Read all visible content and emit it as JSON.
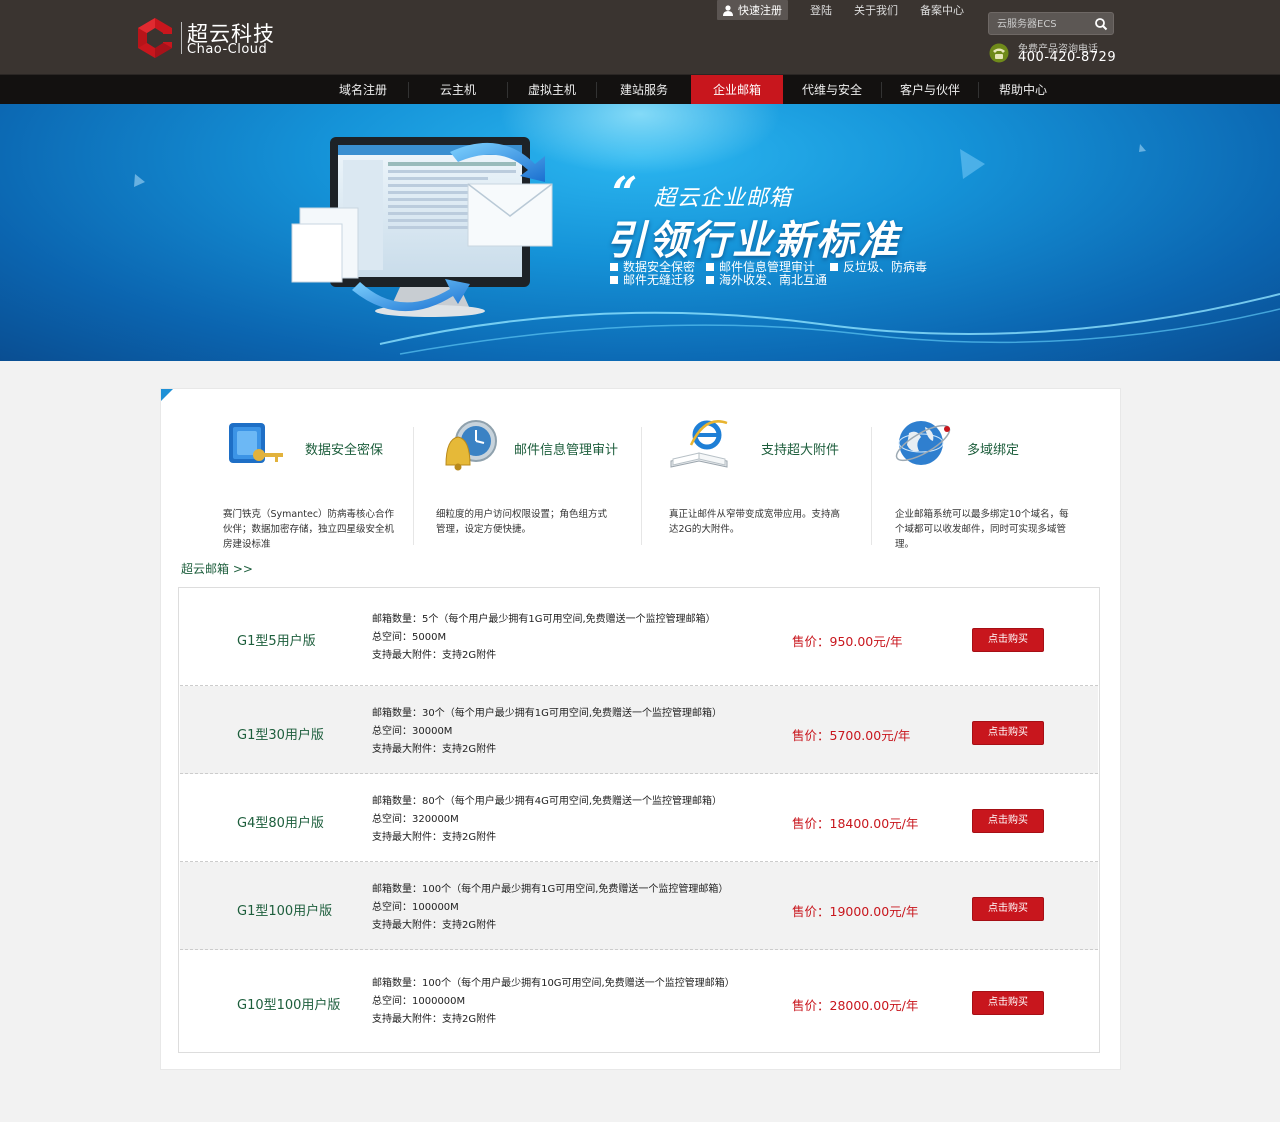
{
  "header": {
    "logo_cn": "超云科技",
    "logo_en": "Chao-Cloud",
    "quick_register": "快速注册",
    "links": [
      "登陆",
      "关于我们",
      "备案中心"
    ],
    "search_placeholder": "云服务器ECS",
    "hotline_label": "免费产品咨询电话",
    "hotline_number": "400-420-8729"
  },
  "nav": {
    "items": [
      "域名注册",
      "云主机",
      "虚拟主机",
      "建站服务",
      "企业邮箱",
      "代维与安全",
      "客户与伙伴",
      "帮助中心"
    ],
    "active_index": 4
  },
  "banner": {
    "quote_mark": "“",
    "title1": "超云企业邮箱",
    "title2": "引领行业新标准",
    "features": [
      "数据安全保密",
      "邮件信息管理审计",
      "反垃圾、防病毒",
      "邮件无缝迁移",
      "海外收发、南北互通"
    ]
  },
  "features": [
    {
      "title": "数据安全密保",
      "desc": "赛门铁克（Symantec）防病毒核心合作伙伴；数据加密存储，独立四星级安全机房建设标准",
      "icon": "key-safe-icon"
    },
    {
      "title": "邮件信息管理审计",
      "desc": "细粒度的用户访问权限设置；角色组方式管理，设定方便快捷。",
      "icon": "bell-clock-icon"
    },
    {
      "title": "支持超大附件",
      "desc": "真正让邮件从窄带变成宽带应用。支持高达2G的大附件。",
      "icon": "ie-book-icon"
    },
    {
      "title": "多域绑定",
      "desc": "企业邮箱系统可以最多绑定10个域名，每个域都可以收发邮件，同时可实现多域管理。",
      "icon": "globe-icon"
    }
  ],
  "section_title": "超云邮箱 >>",
  "plans": [
    {
      "name": "G1型5用户版",
      "details": [
        "邮箱数量：5个（每个用户最少拥有1G可用空间,免费赠送一个监控管理邮箱）",
        "总空间：5000M",
        "支持最大附件：支持2G附件"
      ],
      "price": "售价：950.00元/年",
      "button": "点击购买"
    },
    {
      "name": "G1型30用户版",
      "details": [
        "邮箱数量：30个（每个用户最少拥有1G可用空间,免费赠送一个监控管理邮箱）",
        "总空间：30000M",
        "支持最大附件：支持2G附件"
      ],
      "price": "售价：5700.00元/年",
      "button": "点击购买"
    },
    {
      "name": "G4型80用户版",
      "details": [
        "邮箱数量：80个（每个用户最少拥有4G可用空间,免费赠送一个监控管理邮箱）",
        "总空间：320000M",
        "支持最大附件：支持2G附件"
      ],
      "price": "售价：18400.00元/年",
      "button": "点击购买"
    },
    {
      "name": "G1型100用户版",
      "details": [
        "邮箱数量：100个（每个用户最少拥有1G可用空间,免费赠送一个监控管理邮箱）",
        "总空间：100000M",
        "支持最大附件：支持2G附件"
      ],
      "price": "售价：19000.00元/年",
      "button": "点击购买"
    },
    {
      "name": "G10型100用户版",
      "details": [
        "邮箱数量：100个（每个用户最少拥有10G可用空间,免费赠送一个监控管理邮箱）",
        "总空间：1000000M",
        "支持最大附件：支持2G附件"
      ],
      "price": "售价：28000.00元/年",
      "button": "点击购买"
    }
  ],
  "colors": {
    "accent": "#c8161d",
    "header_bg": "#3a3430",
    "nav_bg": "#131110",
    "green_text": "#1d5e3c",
    "banner_blue": "#1593d8"
  }
}
